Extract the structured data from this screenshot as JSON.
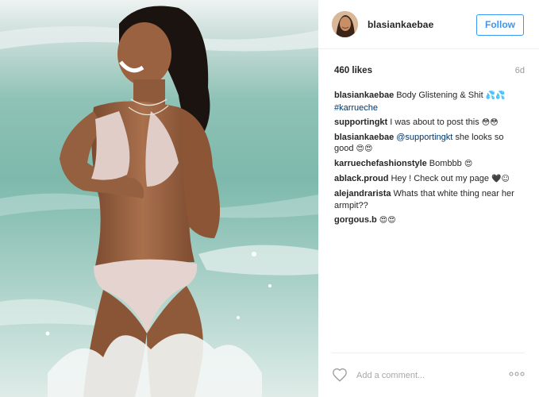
{
  "post": {
    "username": "blasiankaebae",
    "follow_label": "Follow",
    "likes": "460 likes",
    "time_ago": "6d"
  },
  "comments": [
    {
      "author": "blasiankaebae",
      "text": "Body Glistening & Shit ",
      "emoji": "💦💦",
      "link": "#karrueche"
    },
    {
      "author": "supportingkt",
      "text": "I was about to post this ",
      "emoji": "😳😳"
    },
    {
      "author": "blasiankaebae",
      "mention": "@supportingkt",
      "text": " she looks so good ",
      "emoji": "😍😍"
    },
    {
      "author": "karruechefashionstyle",
      "text": "Bombbb ",
      "emoji": "😍"
    },
    {
      "author": "ablack.proud",
      "text": "Hey ! Check out my page ",
      "emoji": "🖤☺"
    },
    {
      "author": "alejandrarista",
      "text": "Whats that white thing near her armpit??"
    },
    {
      "author": "gorgous.b",
      "text": "",
      "emoji": "😍😍"
    }
  ],
  "footer": {
    "comment_placeholder": "Add a comment...",
    "icons": [
      "heart-icon",
      "more-options-icon"
    ]
  },
  "colors": {
    "accent": "#3897f0",
    "hashtag": "#003569",
    "text": "#262626",
    "muted": "#999999"
  }
}
